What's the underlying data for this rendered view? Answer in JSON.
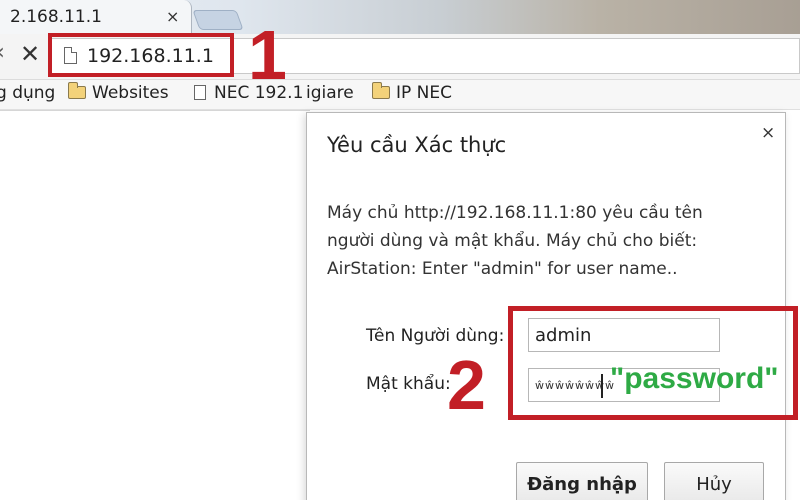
{
  "browser": {
    "tab_title": "2.168.11.1",
    "tab_close": "×",
    "url": "192.168.11.1",
    "nav_stop": "✕"
  },
  "bookmarks": [
    {
      "label": "g dụng",
      "icon": "none"
    },
    {
      "label": "Websites",
      "icon": "folder-icon"
    },
    {
      "label": "NEC 192.1",
      "icon": "page-icon"
    },
    {
      "label": "igiare",
      "icon": "none"
    },
    {
      "label": "IP NEC",
      "icon": "folder-icon"
    }
  ],
  "dialog": {
    "title": "Yêu cầu Xác thực",
    "close": "×",
    "message_lines": [
      "Máy chủ http://192.168.11.1:80 yêu cầu tên",
      "người dùng và mật khẩu. Máy chủ cho biết:",
      "AirStation: Enter \"admin\" for user name.."
    ],
    "username_label": "Tên Người dùng:",
    "username_value": "admin",
    "password_label": "Mật khẩu:",
    "password_mask": "ŵŵŵŵŵŵŵŵ",
    "login_button": "Đăng nhập",
    "cancel_button": "Hủy"
  },
  "annotations": {
    "step_1": "1",
    "step_2": "2",
    "password_hint": "\"password\"",
    "highlight_color": "#c21f26",
    "hint_color": "#2eaa45"
  }
}
